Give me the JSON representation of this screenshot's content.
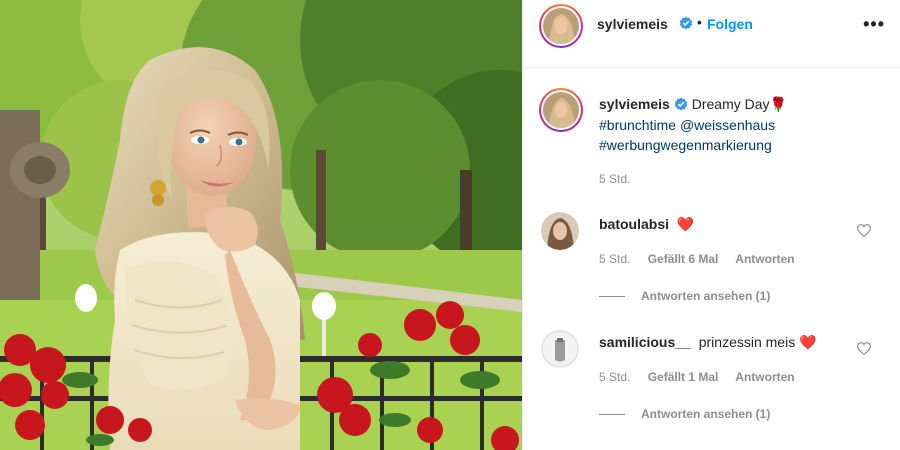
{
  "post": {
    "username": "sylviemeis",
    "separator": "•",
    "follow_label": "Folgen",
    "more_label": "•••",
    "caption": {
      "username": "sylviemeis",
      "text": "Dreamy Day🌹",
      "tags": [
        "#brunchtime",
        "@weissenhaus",
        "#werbungwegenmarkierung"
      ],
      "time": "5 Std."
    }
  },
  "comments": [
    {
      "username": "batoulabsi",
      "text": "❤️",
      "time": "5 Std.",
      "likes": "Gefällt 6 Mal",
      "reply_label": "Antworten",
      "view_replies": "Antworten ansehen (1)"
    },
    {
      "username": "samilicious__",
      "text": "prinzessin meis ❤️",
      "time": "5 Std.",
      "likes": "Gefällt 1 Mal",
      "reply_label": "Antworten",
      "view_replies": "Antworten ansehen (1)"
    }
  ],
  "colors": {
    "link_blue": "#0095f6",
    "hashtag_blue": "#00376b",
    "verified_blue": "#3897f0",
    "secondary_text": "#8e8e8e",
    "heart_red": "#ed4956"
  },
  "icons": [
    "verified-badge-icon",
    "more-options-icon",
    "heart-outline-icon",
    "red-heart-emoji"
  ]
}
